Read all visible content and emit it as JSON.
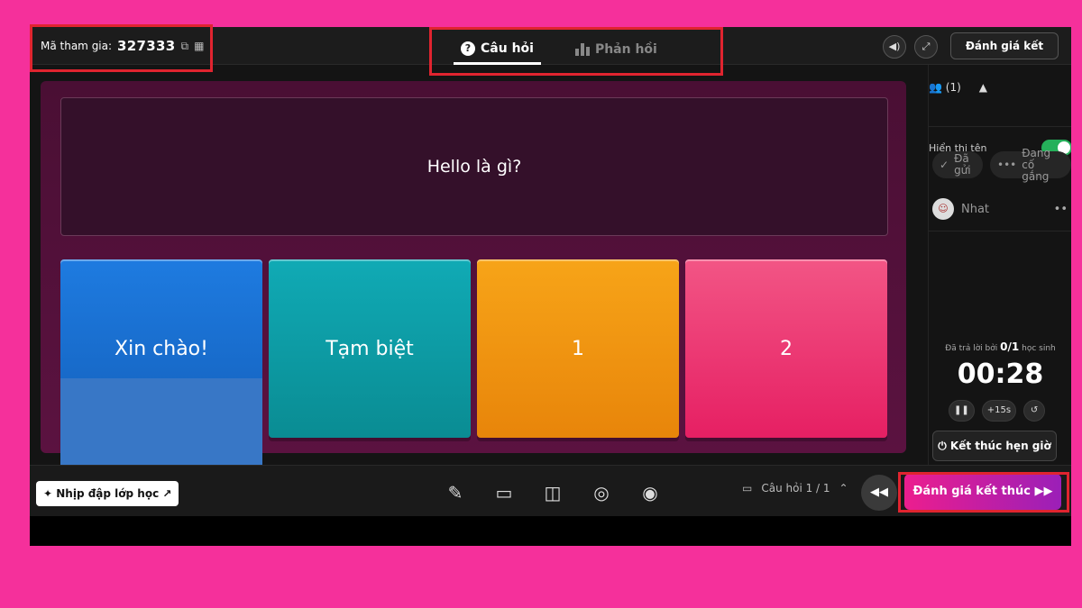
{
  "header": {
    "join_label": "Mã tham gia:",
    "join_code": "327333",
    "copy_icon": "copy-icon",
    "qr_icon": "qr-icon",
    "tabs": [
      {
        "label": "Câu hỏi",
        "active": true,
        "icon": "chat-icon"
      },
      {
        "label": "Phản hồi",
        "active": false,
        "icon": "bar-chart-icon"
      }
    ],
    "end_button": "Đánh giá kết thúc"
  },
  "question": {
    "text": "Hello là gì?",
    "answers": [
      {
        "label": "Xin chào!",
        "color": "#1e7be0"
      },
      {
        "label": "Tạm biệt",
        "color": "#10aab5"
      },
      {
        "label": "1",
        "color": "#f7a418"
      },
      {
        "label": "2",
        "color": "#f25585"
      }
    ]
  },
  "sidebar": {
    "participants": "(1)",
    "show_name_label": "Hiển thị tên",
    "chip_sent": "Đã gửi",
    "chip_trying": "Đang cố gắng",
    "user_name": "Nhat",
    "answered_prefix": "Đã trả lời bởi",
    "answered_count": "0/1",
    "answered_suffix": "học sinh",
    "timer": "00:28",
    "plus_label": "+15s",
    "end_timer_label": "Kết thúc hẹn giờ"
  },
  "bottombar": {
    "rhythm_label": "Nhịp đập lớp học",
    "question_nav": "Câu hỏi 1 / 1",
    "eval_button": "Đánh giá kết thúc"
  },
  "colors": {
    "background": "#f5309b",
    "accent_toggle": "#25b05a",
    "highlight_box": "#e0242f"
  }
}
